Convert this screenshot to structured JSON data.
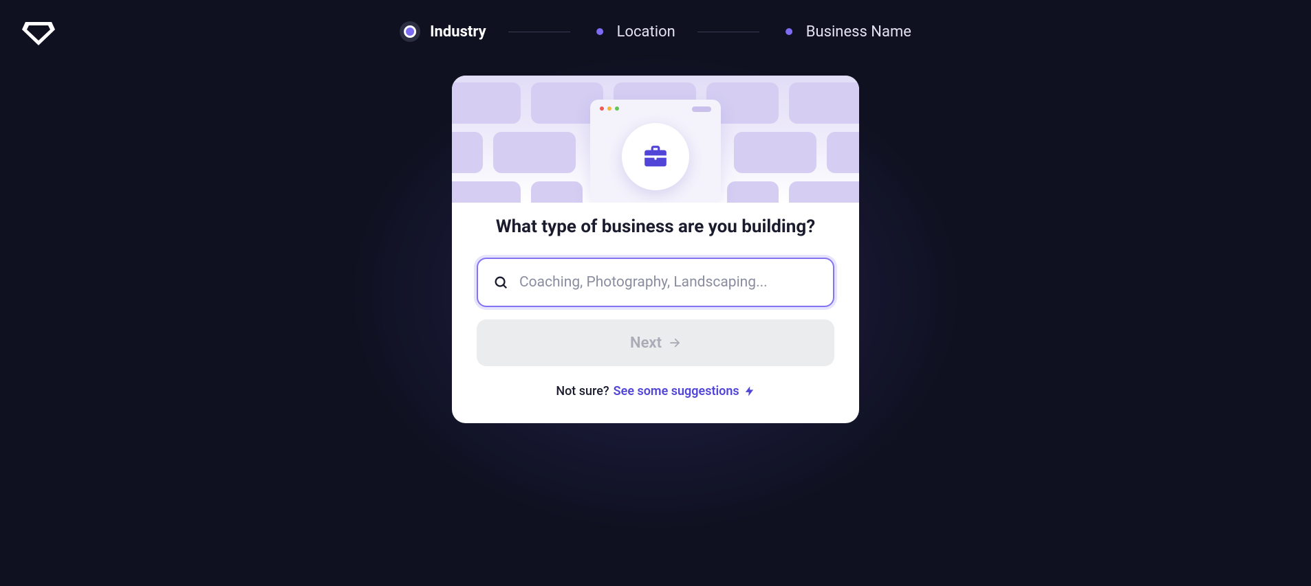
{
  "stepper": {
    "steps": [
      {
        "label": "Industry",
        "active": true
      },
      {
        "label": "Location",
        "active": false
      },
      {
        "label": "Business Name",
        "active": false
      }
    ]
  },
  "card": {
    "title": "What type of business are you building?",
    "search_placeholder": "Coaching, Photography, Landscaping...",
    "search_value": "",
    "next_button_label": "Next",
    "suggestions_prefix": "Not sure?",
    "suggestions_link": "See some suggestions"
  }
}
